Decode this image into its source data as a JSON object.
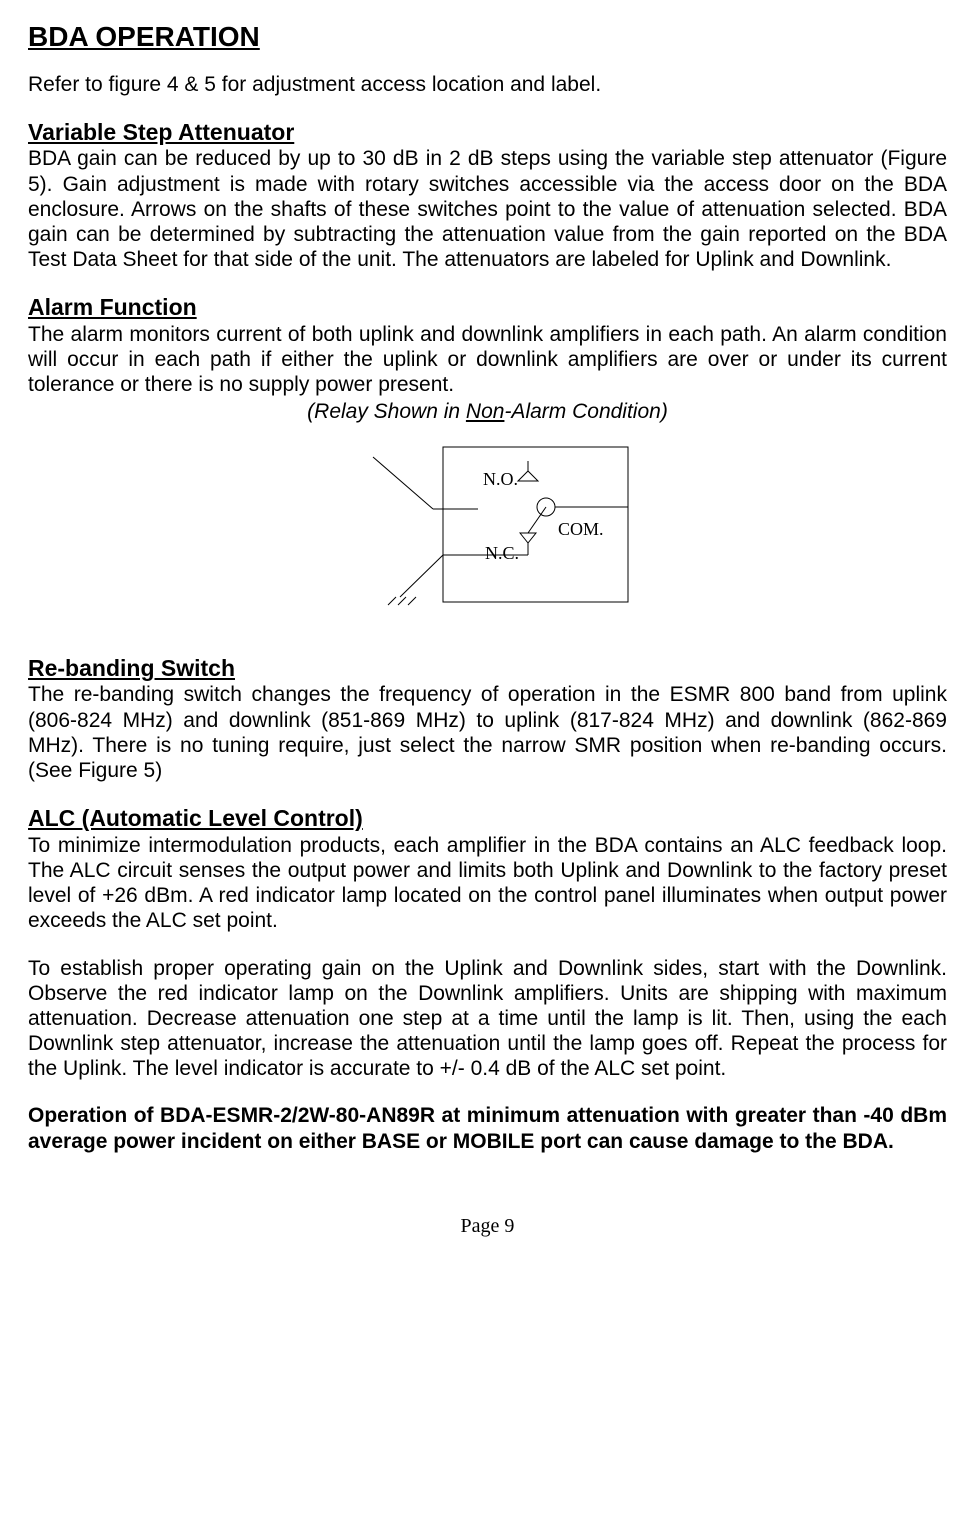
{
  "title": "BDA OPERATION",
  "intro": "Refer to figure 4 & 5 for adjustment access location and label.",
  "sec1": {
    "h": "Variable Step Attenuator",
    "p": "BDA gain can be reduced by up to 30 dB in 2 dB steps using the variable step attenuator (Figure 5). Gain adjustment is made with rotary switches accessible via the access door on the BDA enclosure. Arrows on the shafts of these switches point to the value of attenuation selected. BDA gain can be determined by subtracting the attenuation value from the gain reported on the BDA Test Data Sheet for that side of the unit.  The attenuators are labeled for Uplink and Downlink."
  },
  "sec2": {
    "h": "Alarm Function",
    "p": "The alarm monitors current of both uplink and downlink amplifiers in each path. An alarm condition will occur in each path if either the uplink or downlink amplifiers are over or under its current tolerance or there is no supply power present.",
    "caption_prefix": "(Relay Shown in ",
    "caption_non": "Non",
    "caption_suffix": "-Alarm Condition)",
    "diagram": {
      "no": "N.O.",
      "nc": "N.C.",
      "com": "COM."
    }
  },
  "sec3": {
    "h": "Re-banding Switch",
    "p": "The re-banding switch changes the frequency of operation in the ESMR 800 band from uplink (806-824 MHz) and downlink (851-869 MHz) to uplink (817-824 MHz) and downlink (862-869 MHz). There is no tuning require, just select the narrow SMR position when re-banding occurs. (See Figure 5)"
  },
  "sec4": {
    "h": "ALC (Automatic Level Control)",
    "p1": "To minimize intermodulation products, each amplifier in the BDA contains an ALC feedback loop. The ALC circuit senses the output power and limits both Uplink and Downlink to the factory preset level of +26 dBm. A red indicator lamp located on the control panel illuminates when output power exceeds the ALC set point.",
    "p2": "To establish proper operating gain on the Uplink and Downlink sides, start with the Downlink. Observe the red indicator lamp on the Downlink amplifiers. Units are shipping with maximum attenuation. Decrease attenuation one step at a time until the lamp is lit. Then, using the each Downlink step attenuator, increase the attenuation until the lamp goes off. Repeat the process for the Uplink. The level indicator is accurate to +/- 0.4 dB of the ALC set point.",
    "p3": "Operation of BDA-ESMR-2/2W-80-AN89R at minimum attenuation with greater than -40 dBm average power incident on either BASE or MOBILE port can cause damage to the BDA."
  },
  "footer": "Page 9"
}
